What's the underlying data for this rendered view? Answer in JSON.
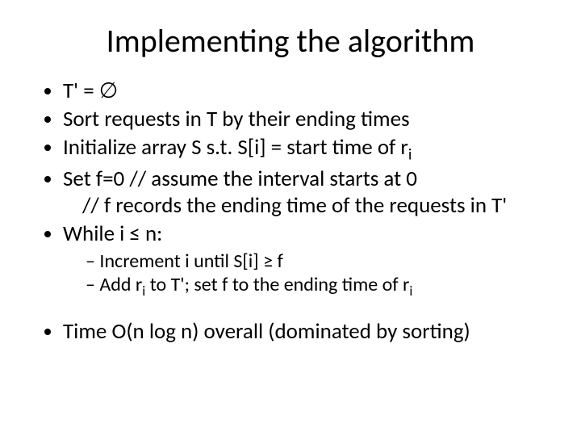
{
  "title": "Implementing the algorithm",
  "bullets": {
    "b1": "T' = ∅",
    "b2": "Sort requests in T by their ending times",
    "b3_a": "Initialize array S s.t. S[i] = start time of r",
    "b3_sub": "i",
    "b4": "Set f=0     // assume the interval starts at 0",
    "b4_cont": "// f records the ending time of the requests in T'",
    "b5": "While i ≤ n:",
    "s1": "Increment i until S[i] ≥ f",
    "s2_a": "Add r",
    "s2_sub1": "i",
    "s2_b": " to T'; set f to the ending time of r",
    "s2_sub2": "i",
    "b6": "Time O(n log n) overall (dominated by sorting)"
  }
}
